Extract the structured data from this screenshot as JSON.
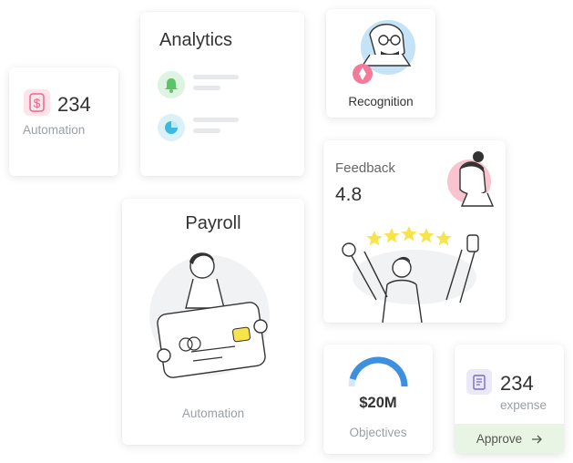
{
  "automation_card": {
    "value": "234",
    "label": "Automation",
    "icon": "dollar-icon"
  },
  "analytics_card": {
    "title": "Analytics",
    "rows": [
      {
        "icon": "bell-icon",
        "color": "#5cc36b"
      },
      {
        "icon": "pie-chart-icon",
        "color": "#3bb9e0"
      }
    ]
  },
  "recognition_card": {
    "label": "Recognition",
    "icon": "award-badge-icon"
  },
  "feedback_card": {
    "title": "Feedback",
    "value": "4.8",
    "stars": 5
  },
  "payroll_card": {
    "title": "Payroll",
    "label": "Automation"
  },
  "objectives_card": {
    "value": "$20M",
    "label": "Objectives",
    "progress_percent": 75
  },
  "expense_card": {
    "value": "234",
    "label": "expense",
    "icon": "receipt-icon",
    "approve_label": "Approve",
    "approve_icon": "arrow-right-icon"
  },
  "colors": {
    "accent_blue": "#3f8fe0",
    "pink": "#f4a3b7",
    "star": "#f7e34a",
    "approve_bg": "#e9f5e4"
  }
}
